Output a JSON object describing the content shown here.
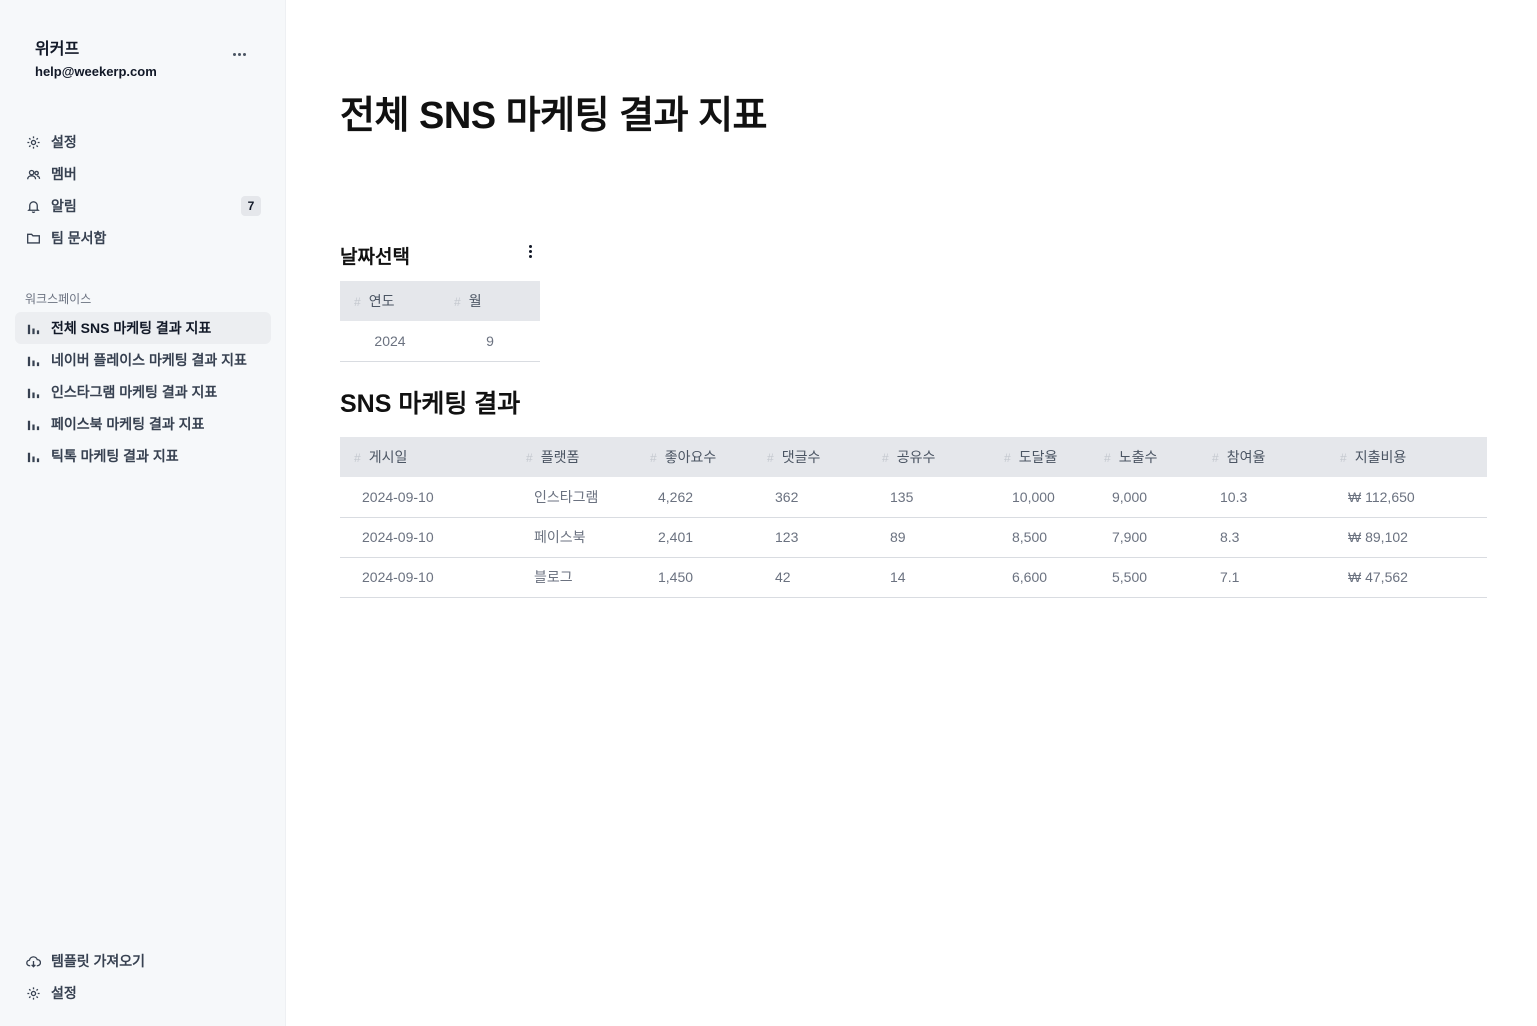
{
  "account": {
    "name": "위커프",
    "email": "help@weekerp.com"
  },
  "top_nav": [
    {
      "label": "설정",
      "icon": "gear-icon"
    },
    {
      "label": "멤버",
      "icon": "members-icon"
    },
    {
      "label": "알림",
      "icon": "bell-icon",
      "badge": "7"
    },
    {
      "label": "팀 문서함",
      "icon": "folder-icon"
    }
  ],
  "workspace": {
    "label": "워크스페이스",
    "items": [
      {
        "label": "전체 SNS 마케팅 결과 지표",
        "icon": "bar-chart-icon",
        "active": true
      },
      {
        "label": "네이버 플레이스 마케팅 결과 지표",
        "icon": "bar-chart-icon"
      },
      {
        "label": "인스타그램 마케팅 결과 지표",
        "icon": "bar-chart-icon"
      },
      {
        "label": "페이스북 마케팅 결과 지표",
        "icon": "bar-chart-icon"
      },
      {
        "label": "틱톡 마케팅 결과 지표",
        "icon": "bar-chart-icon"
      }
    ]
  },
  "bottom_nav": [
    {
      "label": "템플릿 가져오기",
      "icon": "cloud-download-icon"
    },
    {
      "label": "설정",
      "icon": "gear-icon"
    }
  ],
  "page": {
    "title": "전체 SNS 마케팅 결과 지표"
  },
  "date_select": {
    "title": "날짜선택",
    "columns": [
      "연도",
      "월"
    ],
    "values": [
      "2024",
      "9"
    ]
  },
  "results": {
    "title": "SNS 마케팅 결과",
    "columns": [
      "게시일",
      "플랫폼",
      "좋아요수",
      "댓글수",
      "공유수",
      "도달율",
      "노출수",
      "참여율",
      "지출비용"
    ],
    "rows": [
      [
        "2024-09-10",
        "인스타그램",
        "4,262",
        "362",
        "135",
        "10,000",
        "9,000",
        "10.3",
        "₩ 112,650"
      ],
      [
        "2024-09-10",
        "페이스북",
        "2,401",
        "123",
        "89",
        "8,500",
        "7,900",
        "8.3",
        "₩ 89,102"
      ],
      [
        "2024-09-10",
        "블로그",
        "1,450",
        "42",
        "14",
        "6,600",
        "5,500",
        "7.1",
        "₩ 47,562"
      ]
    ]
  },
  "colors": {
    "sidebar_bg": "#f6f8fa",
    "active_item_bg": "#eceef1",
    "table_header_bg": "#e5e7eb",
    "text_primary": "#111827",
    "text_muted": "#6b7280"
  }
}
